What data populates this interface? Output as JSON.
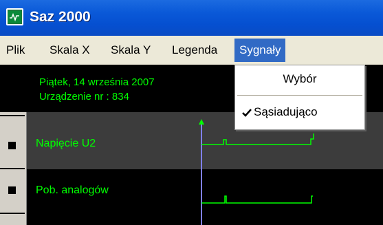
{
  "window": {
    "title": "Saz 2000",
    "icon": "monitor-icon"
  },
  "menu": {
    "items": [
      "Plik",
      "Skala X",
      "Skala Y",
      "Legenda",
      "Sygnały"
    ],
    "active": "Sygnały"
  },
  "dropdown": {
    "items": [
      {
        "label": "Wybór",
        "checked": false
      },
      {
        "label": "Sąsiadująco",
        "checked": true
      }
    ]
  },
  "info": {
    "date": "Piątek, 14  września 2007",
    "device": "Urządzenie nr :  834"
  },
  "channels": [
    {
      "label": "Napięcie U2"
    },
    {
      "label": "Pob. analogów"
    }
  ],
  "colors": {
    "signal": "#00ff00",
    "cursor": "#8080ff",
    "menu_highlight": "#316ac5",
    "channel_bg": "#3c3c3c"
  }
}
